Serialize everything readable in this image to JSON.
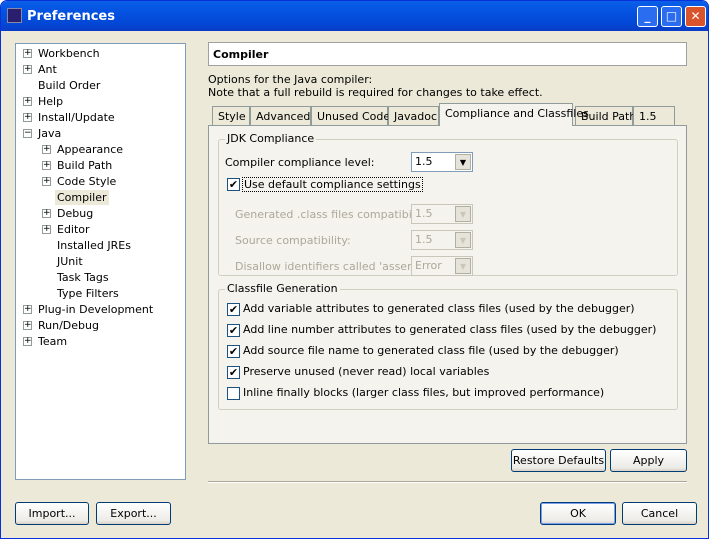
{
  "window": {
    "title": "Preferences",
    "icon": "eclipse-icon",
    "controls": [
      "minimize",
      "maximize",
      "close"
    ]
  },
  "tree": [
    {
      "label": "Workbench",
      "level": 0,
      "expandable": true
    },
    {
      "label": "Ant",
      "level": 0,
      "expandable": true
    },
    {
      "label": "Build Order",
      "level": 0,
      "expandable": false
    },
    {
      "label": "Help",
      "level": 0,
      "expandable": true
    },
    {
      "label": "Install/Update",
      "level": 0,
      "expandable": true
    },
    {
      "label": "Java",
      "level": 0,
      "expandable": true,
      "expanded": true
    },
    {
      "label": "Appearance",
      "level": 1,
      "expandable": true
    },
    {
      "label": "Build Path",
      "level": 1,
      "expandable": true
    },
    {
      "label": "Code Style",
      "level": 1,
      "expandable": true
    },
    {
      "label": "Compiler",
      "level": 1,
      "expandable": false,
      "selected": true
    },
    {
      "label": "Debug",
      "level": 1,
      "expandable": true
    },
    {
      "label": "Editor",
      "level": 1,
      "expandable": true
    },
    {
      "label": "Installed JREs",
      "level": 1,
      "expandable": false
    },
    {
      "label": "JUnit",
      "level": 1,
      "expandable": false
    },
    {
      "label": "Task Tags",
      "level": 1,
      "expandable": false
    },
    {
      "label": "Type Filters",
      "level": 1,
      "expandable": false
    },
    {
      "label": "Plug-in Development",
      "level": 0,
      "expandable": true
    },
    {
      "label": "Run/Debug",
      "level": 0,
      "expandable": true
    },
    {
      "label": "Team",
      "level": 0,
      "expandable": true
    }
  ],
  "page": {
    "title": "Compiler",
    "desc1": "Options for the Java compiler:",
    "desc2": "Note that a full rebuild is required for changes to take effect."
  },
  "tabs": [
    {
      "label": "Style"
    },
    {
      "label": "Advanced"
    },
    {
      "label": "Unused Code"
    },
    {
      "label": "Javadoc"
    },
    {
      "label": "Compliance and Classfiles",
      "active": true
    },
    {
      "label": "Build Path"
    },
    {
      "label": "1.5"
    }
  ],
  "jdk": {
    "legend": "JDK Compliance",
    "level_label": "Compiler compliance level:",
    "level_value": "1.5",
    "use_default_label": "Use default compliance settings",
    "use_default_checked": true,
    "gen_label": "Generated .class files compatibility:",
    "gen_value": "1.5",
    "src_label": "Source compatibility:",
    "src_value": "1.5",
    "assert_label": "Disallow identifiers called 'assert':",
    "assert_value": "Error"
  },
  "classfile": {
    "legend": "Classfile Generation",
    "options": [
      {
        "label": "Add variable attributes to generated class files (used by the debugger)",
        "checked": true
      },
      {
        "label": "Add line number attributes to generated class files (used by the debugger)",
        "checked": true
      },
      {
        "label": "Add source file name to generated class file (used by the debugger)",
        "checked": true
      },
      {
        "label": "Preserve unused (never read) local variables",
        "checked": true
      },
      {
        "label": "Inline finally blocks (larger class files, but improved performance)",
        "checked": false
      }
    ]
  },
  "buttons": {
    "restore": "Restore Defaults",
    "apply": "Apply",
    "import": "Import...",
    "export": "Export...",
    "ok": "OK",
    "cancel": "Cancel"
  }
}
